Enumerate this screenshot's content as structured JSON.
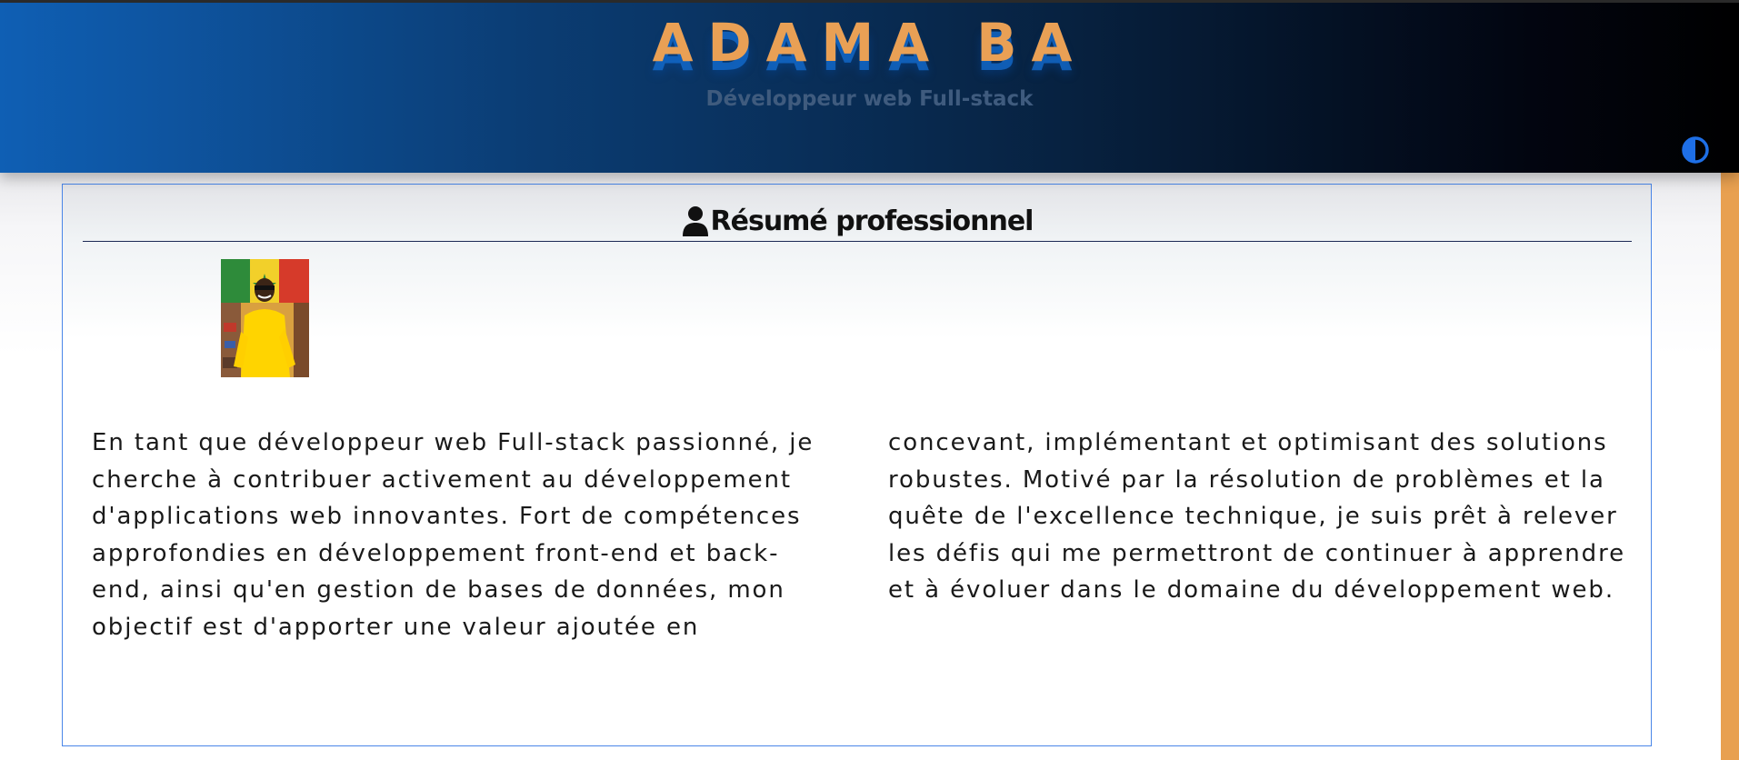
{
  "header": {
    "name": "ADAMA BA",
    "subtitle": "Développeur web Full-stack",
    "theme_toggle_icon": "contrast-half-circle-icon"
  },
  "summary_section": {
    "title": "Résumé professionnel",
    "title_icon": "user-icon",
    "photo": "profile-photo",
    "text": "En tant que développeur web Full-stack passionné, je cherche à contribuer activement au développement d'applications web innovantes. Fort de compétences approfondies en développement front-end et back-end, ainsi qu'en gestion de bases de données, mon objectif est d'apporter une valeur ajoutée en concevant, implémentant et optimisant des solutions robustes. Motivé par la résolution de problèmes et la quête de l'excellence technique, je suis prêt à relever les défis qui me permettront de continuer à apprendre et à évoluer dans le domaine du développement web."
  },
  "colors": {
    "header_gradient_start": "#0f5fb4",
    "header_gradient_end": "#000000",
    "name_color": "#e9a055",
    "subtitle_color": "#3f5b7e",
    "toggle_color": "#1e6fe6",
    "card_border": "#4a86e8",
    "accent_bar": "#e8a050"
  }
}
